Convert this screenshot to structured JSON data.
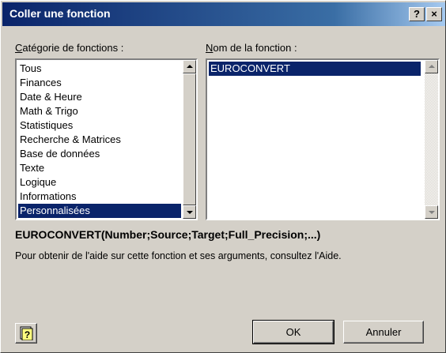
{
  "window": {
    "title": "Coller une fonction",
    "help_button": "?",
    "close_button": "×"
  },
  "categories": {
    "label": "Catégorie de fonctions :",
    "label_accesskey": "C",
    "label_rest": "atégorie de fonctions :",
    "items": [
      {
        "label": "Tous"
      },
      {
        "label": "Finances"
      },
      {
        "label": "Date & Heure"
      },
      {
        "label": "Math & Trigo"
      },
      {
        "label": "Statistiques"
      },
      {
        "label": "Recherche & Matrices"
      },
      {
        "label": "Base de données"
      },
      {
        "label": "Texte"
      },
      {
        "label": "Logique"
      },
      {
        "label": "Informations"
      },
      {
        "label": "Personnalisées"
      }
    ],
    "selected": "Personnalisées"
  },
  "functions": {
    "label": "Nom de la fonction :",
    "label_accesskey": "N",
    "label_rest": "om de la fonction :",
    "items": [
      {
        "label": "EUROCONVERT"
      }
    ],
    "selected": "EUROCONVERT"
  },
  "syntax": "EUROCONVERT(Number;Source;Target;Full_Precision;...)",
  "description": "Pour obtenir de l'aide sur cette fonction et ses arguments, consultez l'Aide.",
  "buttons": {
    "help_icon": "question-icon",
    "ok": "OK",
    "cancel": "Annuler"
  },
  "colors": {
    "title_start": "#0a246a",
    "title_end": "#a6caf0",
    "face": "#d4d0c8",
    "selection": "#0a246a"
  }
}
